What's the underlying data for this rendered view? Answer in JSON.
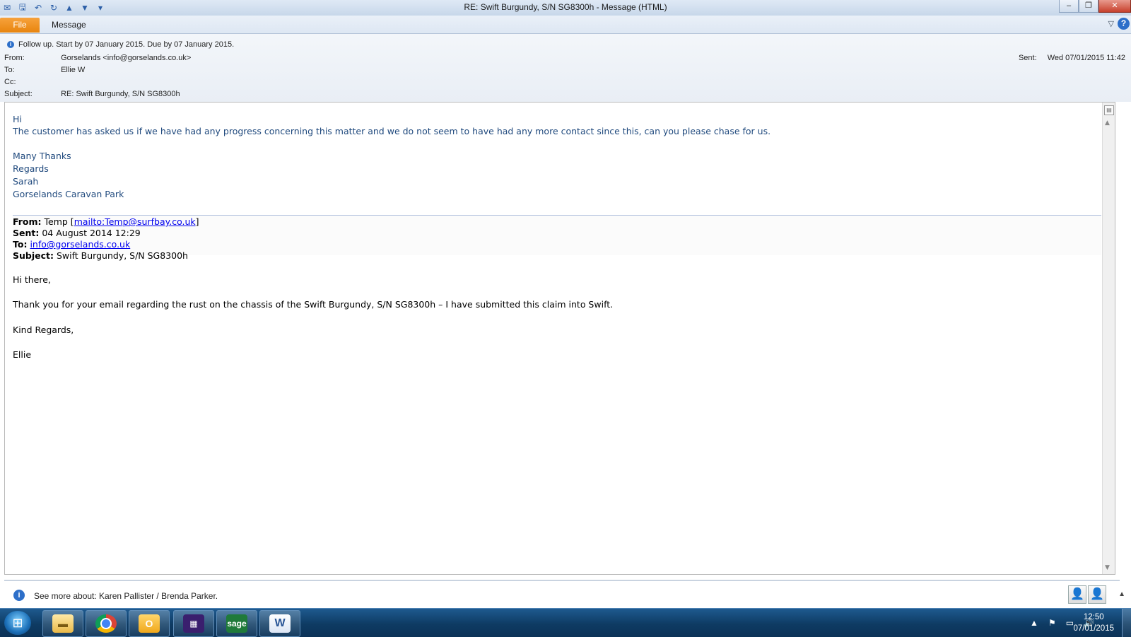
{
  "window": {
    "title": "RE: Swift Burgundy, S/N SG8300h  -  Message (HTML)",
    "controls": {
      "minimize": "–",
      "restore": "❐",
      "close": "✕"
    }
  },
  "quick_access": {
    "icons": [
      "outlook-mail-icon",
      "save-icon",
      "undo-icon",
      "redo-icon",
      "previous-item-icon",
      "next-item-icon",
      "customize-toolbar-icon"
    ]
  },
  "ribbon": {
    "file_label": "File",
    "message_label": "Message"
  },
  "header": {
    "follow_up": "Follow up.  Start by 07 January 2015.  Due by 07 January 2015.",
    "from_label": "From:",
    "from_value": "Gorselands <info@gorselands.co.uk>",
    "to_label": "To:",
    "to_value": "Ellie W",
    "cc_label": "Cc:",
    "cc_value": "",
    "subject_label": "Subject:",
    "subject_value": "RE: Swift Burgundy, S/N SG8300h",
    "sent_label": "Sent:",
    "sent_value": "Wed 07/01/2015 11:42"
  },
  "body": {
    "greeting": "Hi",
    "line1": "The customer has asked us if we have had any progress concerning this matter and we do not seem to have had any more contact since this, can you please chase for us.",
    "thanks": "Many Thanks",
    "regards": "Regards",
    "name": "Sarah",
    "company": "Gorselands Caravan Park",
    "original": {
      "from_label": "From:",
      "from_name": "Temp",
      "from_link": "mailto:Temp@surfbay.co.uk",
      "sent_label": "Sent:",
      "sent_value": "04 August 2014 12:29",
      "to_label": "To:",
      "to_link": "info@gorselands.co.uk",
      "subject_label": "Subject:",
      "subject_value": "Swift Burgundy, S/N SG8300h",
      "greeting": "Hi there,",
      "paragraph": "Thank you for your email regarding the rust on the chassis of the Swift Burgundy, S/N SG8300h – I have submitted this claim into Swift.",
      "kind_regards": "Kind Regards,",
      "signature": "Ellie"
    }
  },
  "people_pane": {
    "text": "See more about: Karen Pallister / Brenda Parker."
  },
  "taskbar": {
    "apps": [
      "windows-explorer",
      "google-chrome",
      "outlook",
      "calendar-app",
      "sage",
      "microsoft-word"
    ],
    "sage_label": "sage",
    "word_label": "W",
    "time": "12:50",
    "date": "07/01/2015"
  }
}
